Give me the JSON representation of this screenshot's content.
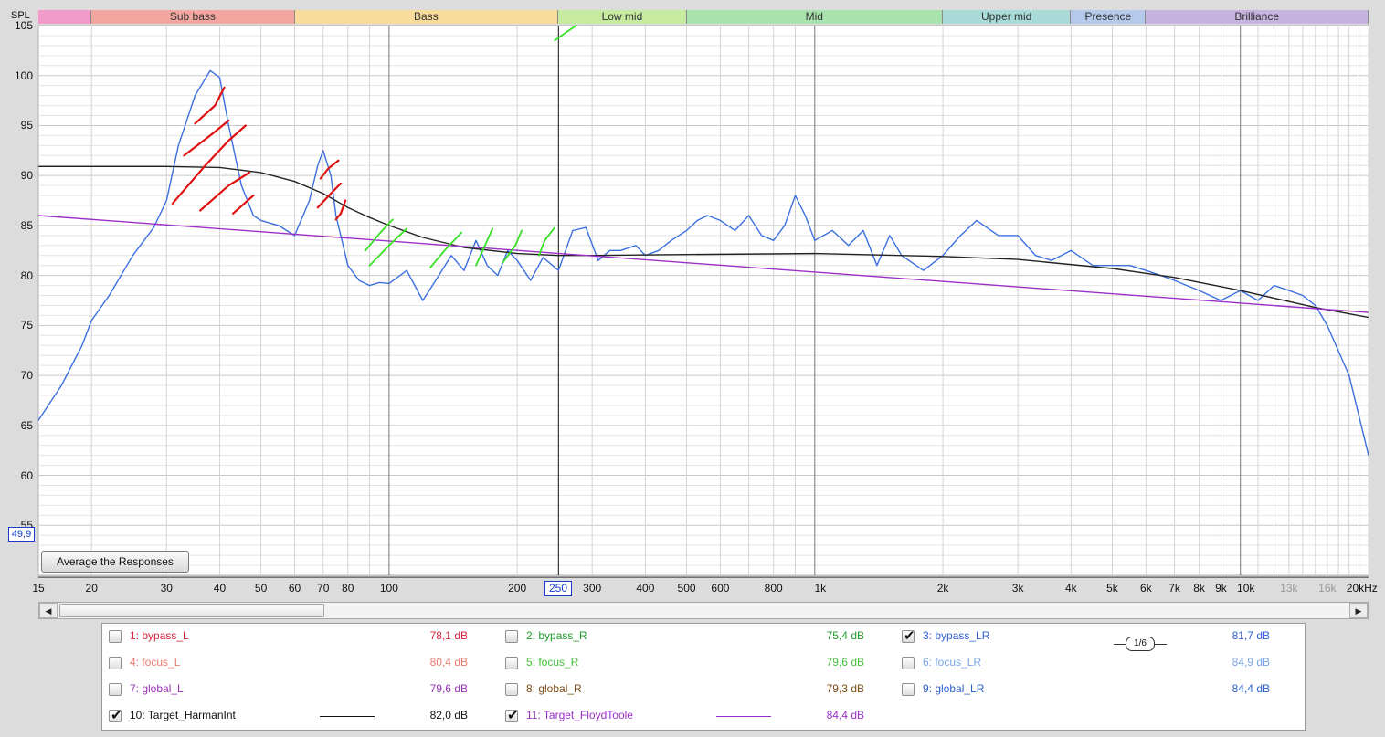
{
  "y_axis": {
    "label": "SPL",
    "ticks": [
      "105",
      "100",
      "95",
      "90",
      "85",
      "80",
      "75",
      "70",
      "65",
      "60",
      "55"
    ]
  },
  "x_axis": {
    "ticks": [
      "15",
      "20",
      "30",
      "40",
      "50",
      "60",
      "70",
      "80",
      "100",
      "200",
      "250",
      "300",
      "400",
      "500",
      "600",
      "800",
      "1k",
      "2k",
      "3k",
      "4k",
      "5k",
      "6k",
      "7k",
      "8k",
      "9k",
      "10k",
      "13k",
      "16k",
      "20kHz"
    ]
  },
  "bands": [
    {
      "label": "",
      "color": "#f29ac9"
    },
    {
      "label": "Sub bass",
      "color": "#f3a6a0"
    },
    {
      "label": "Bass",
      "color": "#f8dc9b"
    },
    {
      "label": "Low mid",
      "color": "#c6eaa0"
    },
    {
      "label": "Mid",
      "color": "#a8e2ad"
    },
    {
      "label": "Upper mid",
      "color": "#a9dcd8"
    },
    {
      "label": "Presence",
      "color": "#b5c9ea"
    },
    {
      "label": "Brilliance",
      "color": "#c7b3df"
    }
  ],
  "cursor": {
    "y_value": "49,9",
    "x_value": "250"
  },
  "average_button": "Average the Responses",
  "legend": [
    {
      "id": "1",
      "name": "1: bypass_L",
      "value": "78,1 dB",
      "checked": false,
      "color": "#d0253a"
    },
    {
      "id": "2",
      "name": "2: bypass_R",
      "value": "75,4 dB",
      "checked": false,
      "color": "#1f9a2c"
    },
    {
      "id": "3",
      "name": "3: bypass_LR",
      "value": "81,7 dB",
      "checked": true,
      "color": "#2d5ed6",
      "smoothing": "1/6"
    },
    {
      "id": "4",
      "name": "4: focus_L",
      "value": "80,4 dB",
      "checked": false,
      "color": "#ee7a6e"
    },
    {
      "id": "5",
      "name": "5: focus_R",
      "value": "79,6 dB",
      "checked": false,
      "color": "#44c23a"
    },
    {
      "id": "6",
      "name": "6: focus_LR",
      "value": "84,9 dB",
      "checked": false,
      "color": "#79a6ea"
    },
    {
      "id": "7",
      "name": "7: global_L",
      "value": "79,6 dB",
      "checked": false,
      "color": "#9a2fb8"
    },
    {
      "id": "8",
      "name": "8: global_R",
      "value": "79,3 dB",
      "checked": false,
      "color": "#7a4a12"
    },
    {
      "id": "9",
      "name": "9: global_LR",
      "value": "84,4 dB",
      "checked": false,
      "color": "#2a60c8"
    },
    {
      "id": "10",
      "name": "10: Target_HarmanInt",
      "value": "82,0 dB",
      "checked": true,
      "color": "#111111"
    },
    {
      "id": "11",
      "name": "11: Target_FloydToole",
      "value": "84,4 dB",
      "checked": true,
      "color": "#9b2fc8"
    }
  ],
  "chart_data": {
    "type": "line",
    "xlabel": "",
    "ylabel": "SPL",
    "x_scale": "log",
    "xlim": [
      15,
      20000
    ],
    "ylim": [
      50,
      105
    ],
    "grid": true,
    "series": [
      {
        "name": "3: bypass_LR",
        "color": "#3b6fe0",
        "x": [
          15,
          17,
          19,
          20,
          22,
          25,
          28,
          30,
          32,
          35,
          38,
          40,
          42,
          45,
          48,
          50,
          55,
          60,
          65,
          68,
          70,
          73,
          75,
          78,
          80,
          85,
          90,
          95,
          100,
          110,
          120,
          130,
          140,
          150,
          160,
          170,
          180,
          190,
          200,
          215,
          230,
          250,
          270,
          290,
          310,
          330,
          350,
          380,
          400,
          430,
          460,
          500,
          530,
          560,
          600,
          650,
          700,
          750,
          800,
          850,
          900,
          950,
          1000,
          1100,
          1200,
          1300,
          1400,
          1500,
          1600,
          1800,
          2000,
          2200,
          2400,
          2700,
          3000,
          3300,
          3600,
          4000,
          4500,
          5000,
          5500,
          6000,
          6500,
          7000,
          8000,
          9000,
          10000,
          11000,
          12000,
          13000,
          14000,
          15000,
          16000,
          18000,
          20000
        ],
        "y": [
          65.5,
          69,
          73,
          75.5,
          78,
          82,
          84.8,
          87.5,
          93,
          98,
          100.5,
          99.8,
          95,
          89,
          86,
          85.5,
          85,
          84,
          87.5,
          91,
          92.5,
          90,
          86,
          83,
          81,
          79.5,
          79,
          79.3,
          79.2,
          80.5,
          77.5,
          79.8,
          82,
          80.5,
          83.5,
          81,
          80,
          82.5,
          81.5,
          79.5,
          81.8,
          80.5,
          84.5,
          84.8,
          81.5,
          82.5,
          82.5,
          83,
          82,
          82.5,
          83.5,
          84.5,
          85.5,
          86,
          85.5,
          84.5,
          86,
          84,
          83.5,
          85,
          88,
          86,
          83.5,
          84.5,
          83,
          84.5,
          81,
          84,
          82,
          80.5,
          82,
          84,
          85.5,
          84,
          84,
          82,
          81.5,
          82.5,
          81,
          81,
          81,
          80.5,
          80,
          79.5,
          78.5,
          77.5,
          78.5,
          77.5,
          79,
          78.5,
          78,
          77,
          75,
          70,
          62
        ]
      },
      {
        "name": "10: Target_HarmanInt",
        "color": "#222222",
        "x": [
          15,
          30,
          40,
          50,
          60,
          70,
          80,
          90,
          100,
          120,
          150,
          200,
          250,
          300,
          500,
          1000,
          2000,
          3000,
          5000,
          7000,
          10000,
          15000,
          20000
        ],
        "y": [
          90.9,
          90.9,
          90.8,
          90.3,
          89.4,
          88.2,
          86.8,
          85.8,
          85,
          83.8,
          82.8,
          82.2,
          82,
          82,
          82.1,
          82.2,
          81.9,
          81.6,
          80.7,
          79.8,
          78.5,
          76.8,
          75.8
        ]
      },
      {
        "name": "11: Target_FloydToole",
        "color": "#9b2fc8",
        "x": [
          15,
          20000
        ],
        "y": [
          86,
          76.3
        ]
      }
    ]
  }
}
